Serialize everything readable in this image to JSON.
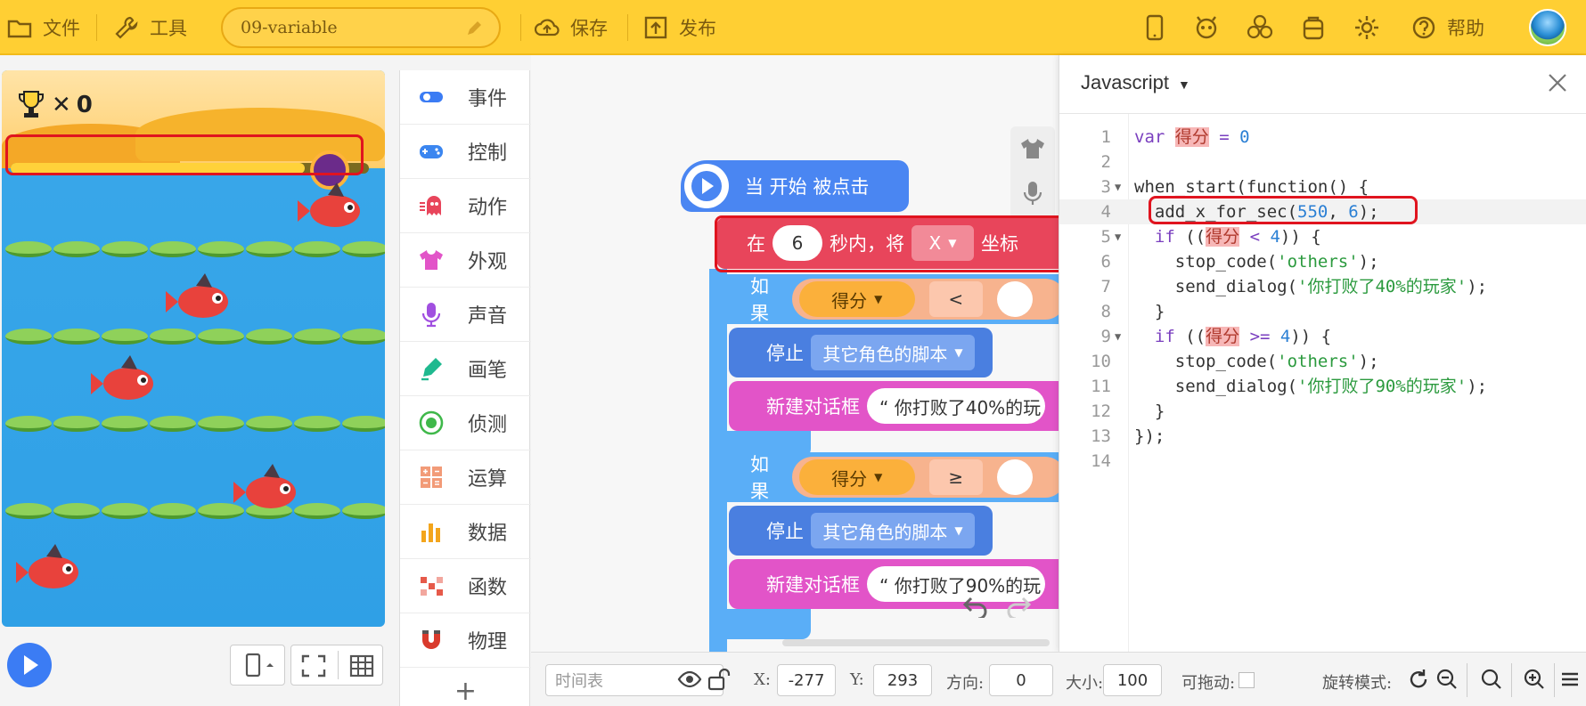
{
  "topbar": {
    "file_label": "文件",
    "tools_label": "工具",
    "project_name": "09-variable",
    "save_label": "保存",
    "publish_label": "发布",
    "help_label": "帮助"
  },
  "stage": {
    "score": "0",
    "timer_progress": 0.82
  },
  "categories": [
    {
      "label": "事件",
      "color": "#3b7cf4"
    },
    {
      "label": "控制",
      "color": "#3b86f0"
    },
    {
      "label": "动作",
      "color": "#e8455b"
    },
    {
      "label": "外观",
      "color": "#e254c8"
    },
    {
      "label": "声音",
      "color": "#a14fe0"
    },
    {
      "label": "画笔",
      "color": "#1fb98f"
    },
    {
      "label": "侦测",
      "color": "#3fb84a"
    },
    {
      "label": "运算",
      "color": "#f29b78"
    },
    {
      "label": "数据",
      "color": "#f3a51c"
    },
    {
      "label": "函数",
      "color": "#e65a4a"
    },
    {
      "label": "物理",
      "color": "#d93a2c"
    }
  ],
  "blocks": {
    "hat": "当 开始 被点击",
    "move_prefix": "在",
    "move_seconds": "6",
    "move_mid": "秒内，将",
    "move_axis": "X",
    "move_suffix": "坐标",
    "if1_label": "如果",
    "if1_var": "得分",
    "if1_op": "<",
    "stop1_label": "停止",
    "stop1_target": "其它角色的脚本",
    "dialog1_label": "新建对话框",
    "dialog1_text": "“ 你打败了40%的玩",
    "if2_label": "如果",
    "if2_var": "得分",
    "if2_op": "≥",
    "stop2_label": "停止",
    "stop2_target": "其它角色的脚本",
    "dialog2_label": "新建对话框",
    "dialog2_text": "“ 你打败了90%的玩"
  },
  "code_panel": {
    "language": "Javascript",
    "lines": [
      {
        "n": "1"
      },
      {
        "n": "2"
      },
      {
        "n": "3"
      },
      {
        "n": "4"
      },
      {
        "n": "5"
      },
      {
        "n": "6"
      },
      {
        "n": "7"
      },
      {
        "n": "8"
      },
      {
        "n": "9"
      },
      {
        "n": "10"
      },
      {
        "n": "11"
      },
      {
        "n": "12"
      },
      {
        "n": "13"
      },
      {
        "n": "14"
      }
    ],
    "code": {
      "l1_kw": "var ",
      "l1_var": "得分",
      "l1_rest": " = ",
      "l1_num": "0",
      "l3": "when_start(function() {",
      "l4_a": "  add_x_for_sec(",
      "l4_n1": "550",
      "l4_b": ", ",
      "l4_n2": "6",
      "l4_c": ");",
      "l5_a": "  ",
      "l5_kw": "if",
      "l5_b": " ((",
      "l5_var": "得分",
      "l5_c": " < ",
      "l5_num": "4",
      "l5_d": ")) {",
      "l6_a": "    stop_code(",
      "l6_str": "'others'",
      "l6_b": ");",
      "l7_a": "    send_dialog(",
      "l7_str": "'你打败了40%的玩家'",
      "l7_b": ");",
      "l8": "  }",
      "l9_a": "  ",
      "l9_kw": "if",
      "l9_b": " ((",
      "l9_var": "得分",
      "l9_c": " >= ",
      "l9_num": "4",
      "l9_d": ")) {",
      "l10_a": "    stop_code(",
      "l10_str": "'others'",
      "l10_b": ");",
      "l11_a": "    send_dialog(",
      "l11_str": "'你打败了90%的玩家'",
      "l11_b": ");",
      "l12": "  }",
      "l13": "});"
    }
  },
  "bottombar": {
    "timeline_placeholder": "时间表",
    "x_label": "X:",
    "x_value": "-277",
    "y_label": "Y:",
    "y_value": "293",
    "direction_label": "方向:",
    "direction_value": "0",
    "size_label": "大小:",
    "size_value": "100",
    "draggable_label": "可拖动:",
    "rotation_label": "旋转模式:"
  }
}
